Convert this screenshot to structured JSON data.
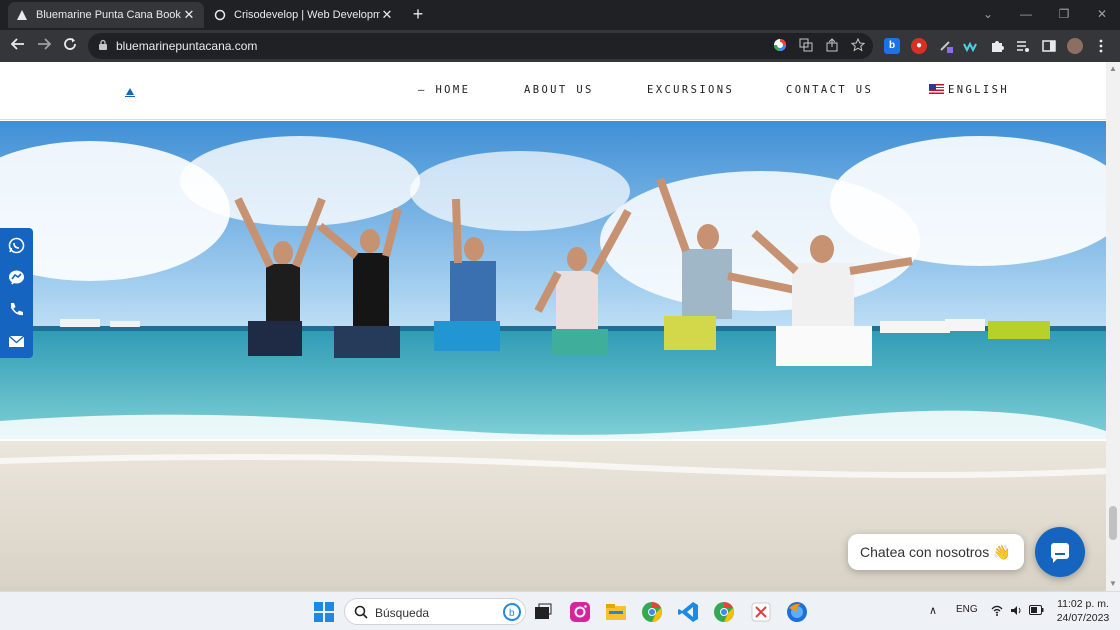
{
  "browser": {
    "tabs": [
      {
        "title": "Bluemarine Punta Cana Book You",
        "close": "✕"
      },
      {
        "title": "Crisodevelop | Web Developmen",
        "close": "✕"
      }
    ],
    "new_tab": "+",
    "window_controls": {
      "minimize": "⌄",
      "restore": "—",
      "maximize": "❐",
      "close": "✕"
    },
    "url": "bluemarinepuntacana.com"
  },
  "site": {
    "nav": [
      {
        "label": "— HOME"
      },
      {
        "label": "ABOUT US"
      },
      {
        "label": "EXCURSIONS"
      },
      {
        "label": "CONTACT US"
      },
      {
        "label": "ENGLISH"
      }
    ]
  },
  "chat": {
    "label": "Chatea con nosotros 👋"
  },
  "taskbar": {
    "search_placeholder": "Búsqueda",
    "language": "ENG",
    "time": "11:02 p. m.",
    "date": "24/07/2023"
  },
  "colors": {
    "accent": "#1565c0",
    "browser_dark": "#202124",
    "toolbar": "#35363a"
  }
}
